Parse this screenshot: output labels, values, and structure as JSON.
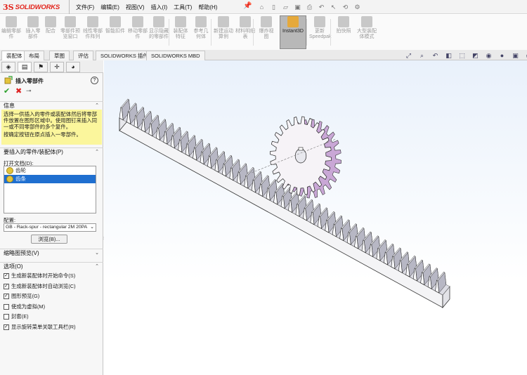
{
  "app": {
    "brand_ds": "3S",
    "brand_name": "SOLIDWORKS",
    "menus": [
      "文件(F)",
      "编辑(E)",
      "视图(V)",
      "插入(I)",
      "工具(T)",
      "帮助(H)"
    ],
    "quick_access_icons": [
      "home-icon",
      "new-icon",
      "open-icon",
      "save-icon",
      "print-icon",
      "undo-icon",
      "select-icon",
      "rebuild-icon",
      "options-icon"
    ]
  },
  "command_manager": {
    "buttons": [
      {
        "label": "编辑零部件",
        "icon": "edit-component-icon"
      },
      {
        "label": "插入零部件",
        "icon": "insert-component-icon"
      },
      {
        "label": "配合",
        "icon": "mate-icon"
      },
      {
        "label": "零部件预览窗口",
        "icon": "component-preview-icon"
      },
      {
        "label": "线性零部件阵列",
        "icon": "linear-pattern-icon"
      },
      {
        "label": "智能扣件",
        "icon": "smart-fastener-icon"
      },
      {
        "label": "移动零部件",
        "icon": "move-component-icon"
      },
      {
        "label": "显示隐藏的零部件",
        "icon": "show-hidden-icon"
      },
      {
        "label": "装配体特征",
        "icon": "assembly-feature-icon"
      },
      {
        "label": "参考几何体",
        "icon": "reference-geometry-icon"
      },
      {
        "label": "新建运动算例",
        "icon": "motion-study-icon"
      },
      {
        "label": "材料明细表",
        "icon": "bom-icon"
      },
      {
        "label": "爆炸视图",
        "icon": "exploded-view-icon"
      },
      {
        "label": "Instant3D",
        "icon": "instant3d-icon",
        "active": true
      },
      {
        "label": "更新Speedpak",
        "icon": "speedpak-icon"
      },
      {
        "label": "拍快照",
        "icon": "snapshot-icon"
      },
      {
        "label": "大型装配体模式",
        "icon": "large-assembly-icon"
      }
    ]
  },
  "tabs": [
    "装配体",
    "布局",
    "草图",
    "评估",
    "SOLIDWORKS 插件",
    "SOLIDWORKS MBD"
  ],
  "panel": {
    "title": "插入零部件",
    "help": "?",
    "info_header": "信息",
    "info_text_1": "选择一供插入的零件或装配体然后将零部件放置在图形区域中。使用图钉来插入同一或不同零部件的多个复件。",
    "info_text_2": "按确定按钮在原点插入一零部件。",
    "parts_header": "要插入的零件/装配体(P)",
    "open_docs_label": "打开文档(D):",
    "documents": [
      {
        "name": "齿轮",
        "selected": false
      },
      {
        "name": "齿条",
        "selected": true
      }
    ],
    "config_label": "配置:",
    "config_value": "GB - Rack-spur - rectangular 2M 20PA",
    "browse_label": "浏览(B)...",
    "thumb_header": "缩略图预览(V)",
    "options_header": "选项(O)",
    "options": [
      {
        "label": "生成新装配体时开始命令(S)",
        "checked": true
      },
      {
        "label": "生成新装配体时自动浏览(C)",
        "checked": true
      },
      {
        "label": "图形预览(G)",
        "checked": true
      },
      {
        "label": "使成为虚拟(M)",
        "checked": false
      },
      {
        "label": "封套(E)",
        "checked": false
      },
      {
        "label": "显示旋转菜单关联工具栏(R)",
        "checked": true
      }
    ]
  },
  "colors": {
    "accent": "#1f6fd0",
    "brand": "#e2231a",
    "info_bg": "#fbf69c",
    "gear_face": "#f6f3f7",
    "gear_side": "#c9a7d6"
  },
  "scene": {
    "gear_teeth": 24,
    "rack_teeth": 44
  }
}
